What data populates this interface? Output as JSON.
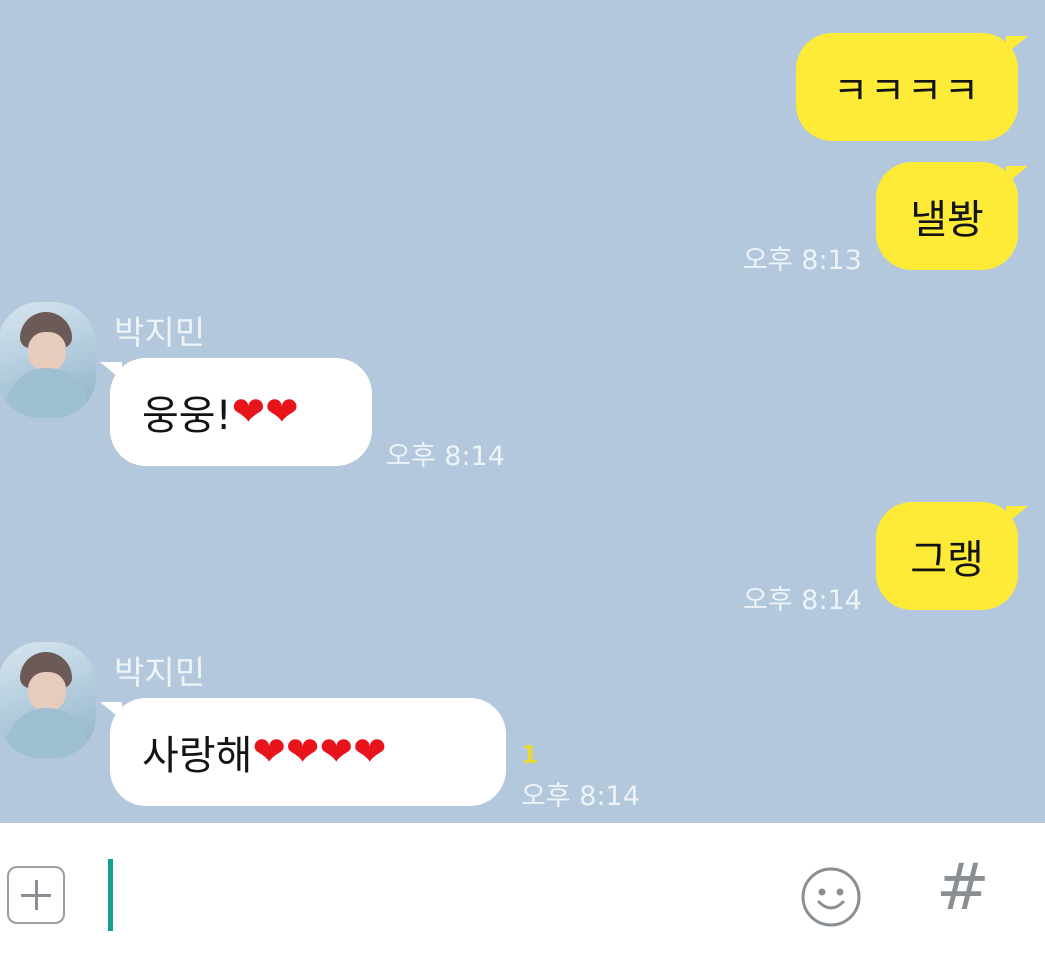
{
  "messages": [
    {
      "side": "mine",
      "text": "ㅋㅋㅋㅋ"
    },
    {
      "side": "mine",
      "text": "낼봥",
      "time": "오후 8:13"
    },
    {
      "side": "theirs",
      "sender": "박지민",
      "text": "웅웅!",
      "hearts": "❤❤",
      "time": "오후 8:14"
    },
    {
      "side": "mine",
      "text": "그랭",
      "time": "오후 8:14"
    },
    {
      "side": "theirs",
      "sender": "박지민",
      "text": "사랑해",
      "hearts": "❤❤❤❤",
      "time": "오후 8:14",
      "unread": "1"
    }
  ],
  "input_bar": {
    "text": "",
    "add_icon": "plus-square-icon",
    "emoji_icon": "smiley-face-icon",
    "hashtag_label": "#"
  },
  "colors": {
    "chat_background": "#b3c8dc",
    "my_bubble": "#fdeb37",
    "their_bubble": "#ffffff",
    "heart": "#e8141c",
    "cursor": "#13a08c",
    "unread": "#e8d83a"
  }
}
